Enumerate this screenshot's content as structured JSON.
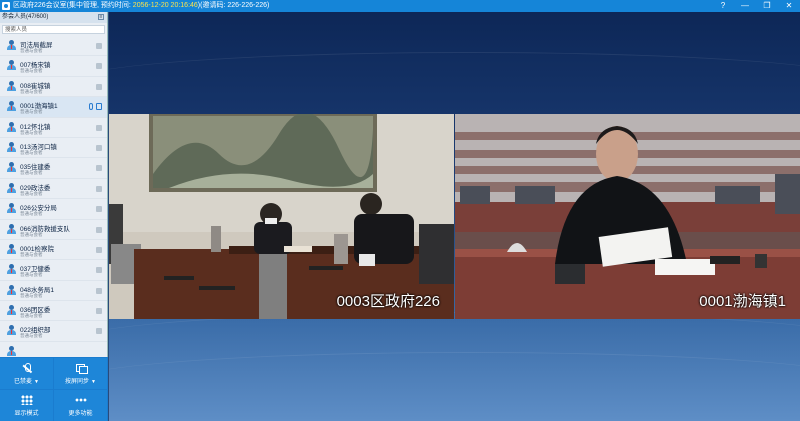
{
  "titlebar": {
    "title": "区政府226会议室(集中管理, 预约时间: ",
    "time": "2056-12-20 20:16:46",
    "suffix": ")(邀请码: 226-226-226)",
    "controls": [
      "?",
      "—",
      "❐",
      "✕"
    ]
  },
  "sidebar": {
    "header": "参会人员(47/600)",
    "collapse": "≡",
    "search_placeholder": "搜索人员",
    "items": [
      {
        "name": "司法局截屏",
        "sub": "普通与会者"
      },
      {
        "name": "007杨宋镇",
        "sub": "普通与会者"
      },
      {
        "name": "008崔城镇",
        "sub": "普通与会者"
      },
      {
        "name": "0001渤海镇1",
        "sub": "普通与会者"
      },
      {
        "name": "012怀北镇",
        "sub": "普通与会者"
      },
      {
        "name": "013汤河口镇",
        "sub": "普通与会者"
      },
      {
        "name": "035住建委",
        "sub": "普通与会者"
      },
      {
        "name": "029政法委",
        "sub": "普通与会者"
      },
      {
        "name": "026公安分局",
        "sub": "普通与会者"
      },
      {
        "name": "066消防救援支队",
        "sub": "普通与会者"
      },
      {
        "name": "0001检察院",
        "sub": "普通与会者"
      },
      {
        "name": "037卫健委",
        "sub": "普通与会者"
      },
      {
        "name": "048水务局1",
        "sub": "普通与会者"
      },
      {
        "name": "036团区委",
        "sub": "普通与会者"
      },
      {
        "name": "022组织部",
        "sub": "普通与会者"
      },
      {
        "name": "",
        "sub": ""
      }
    ],
    "tools": {
      "mute": "已禁麦",
      "sync": "按屏同步",
      "layout": "显示模式",
      "more": "更多功能"
    }
  },
  "videos": {
    "left_caption": "0003区政府226",
    "right_caption": "0001渤海镇1"
  }
}
